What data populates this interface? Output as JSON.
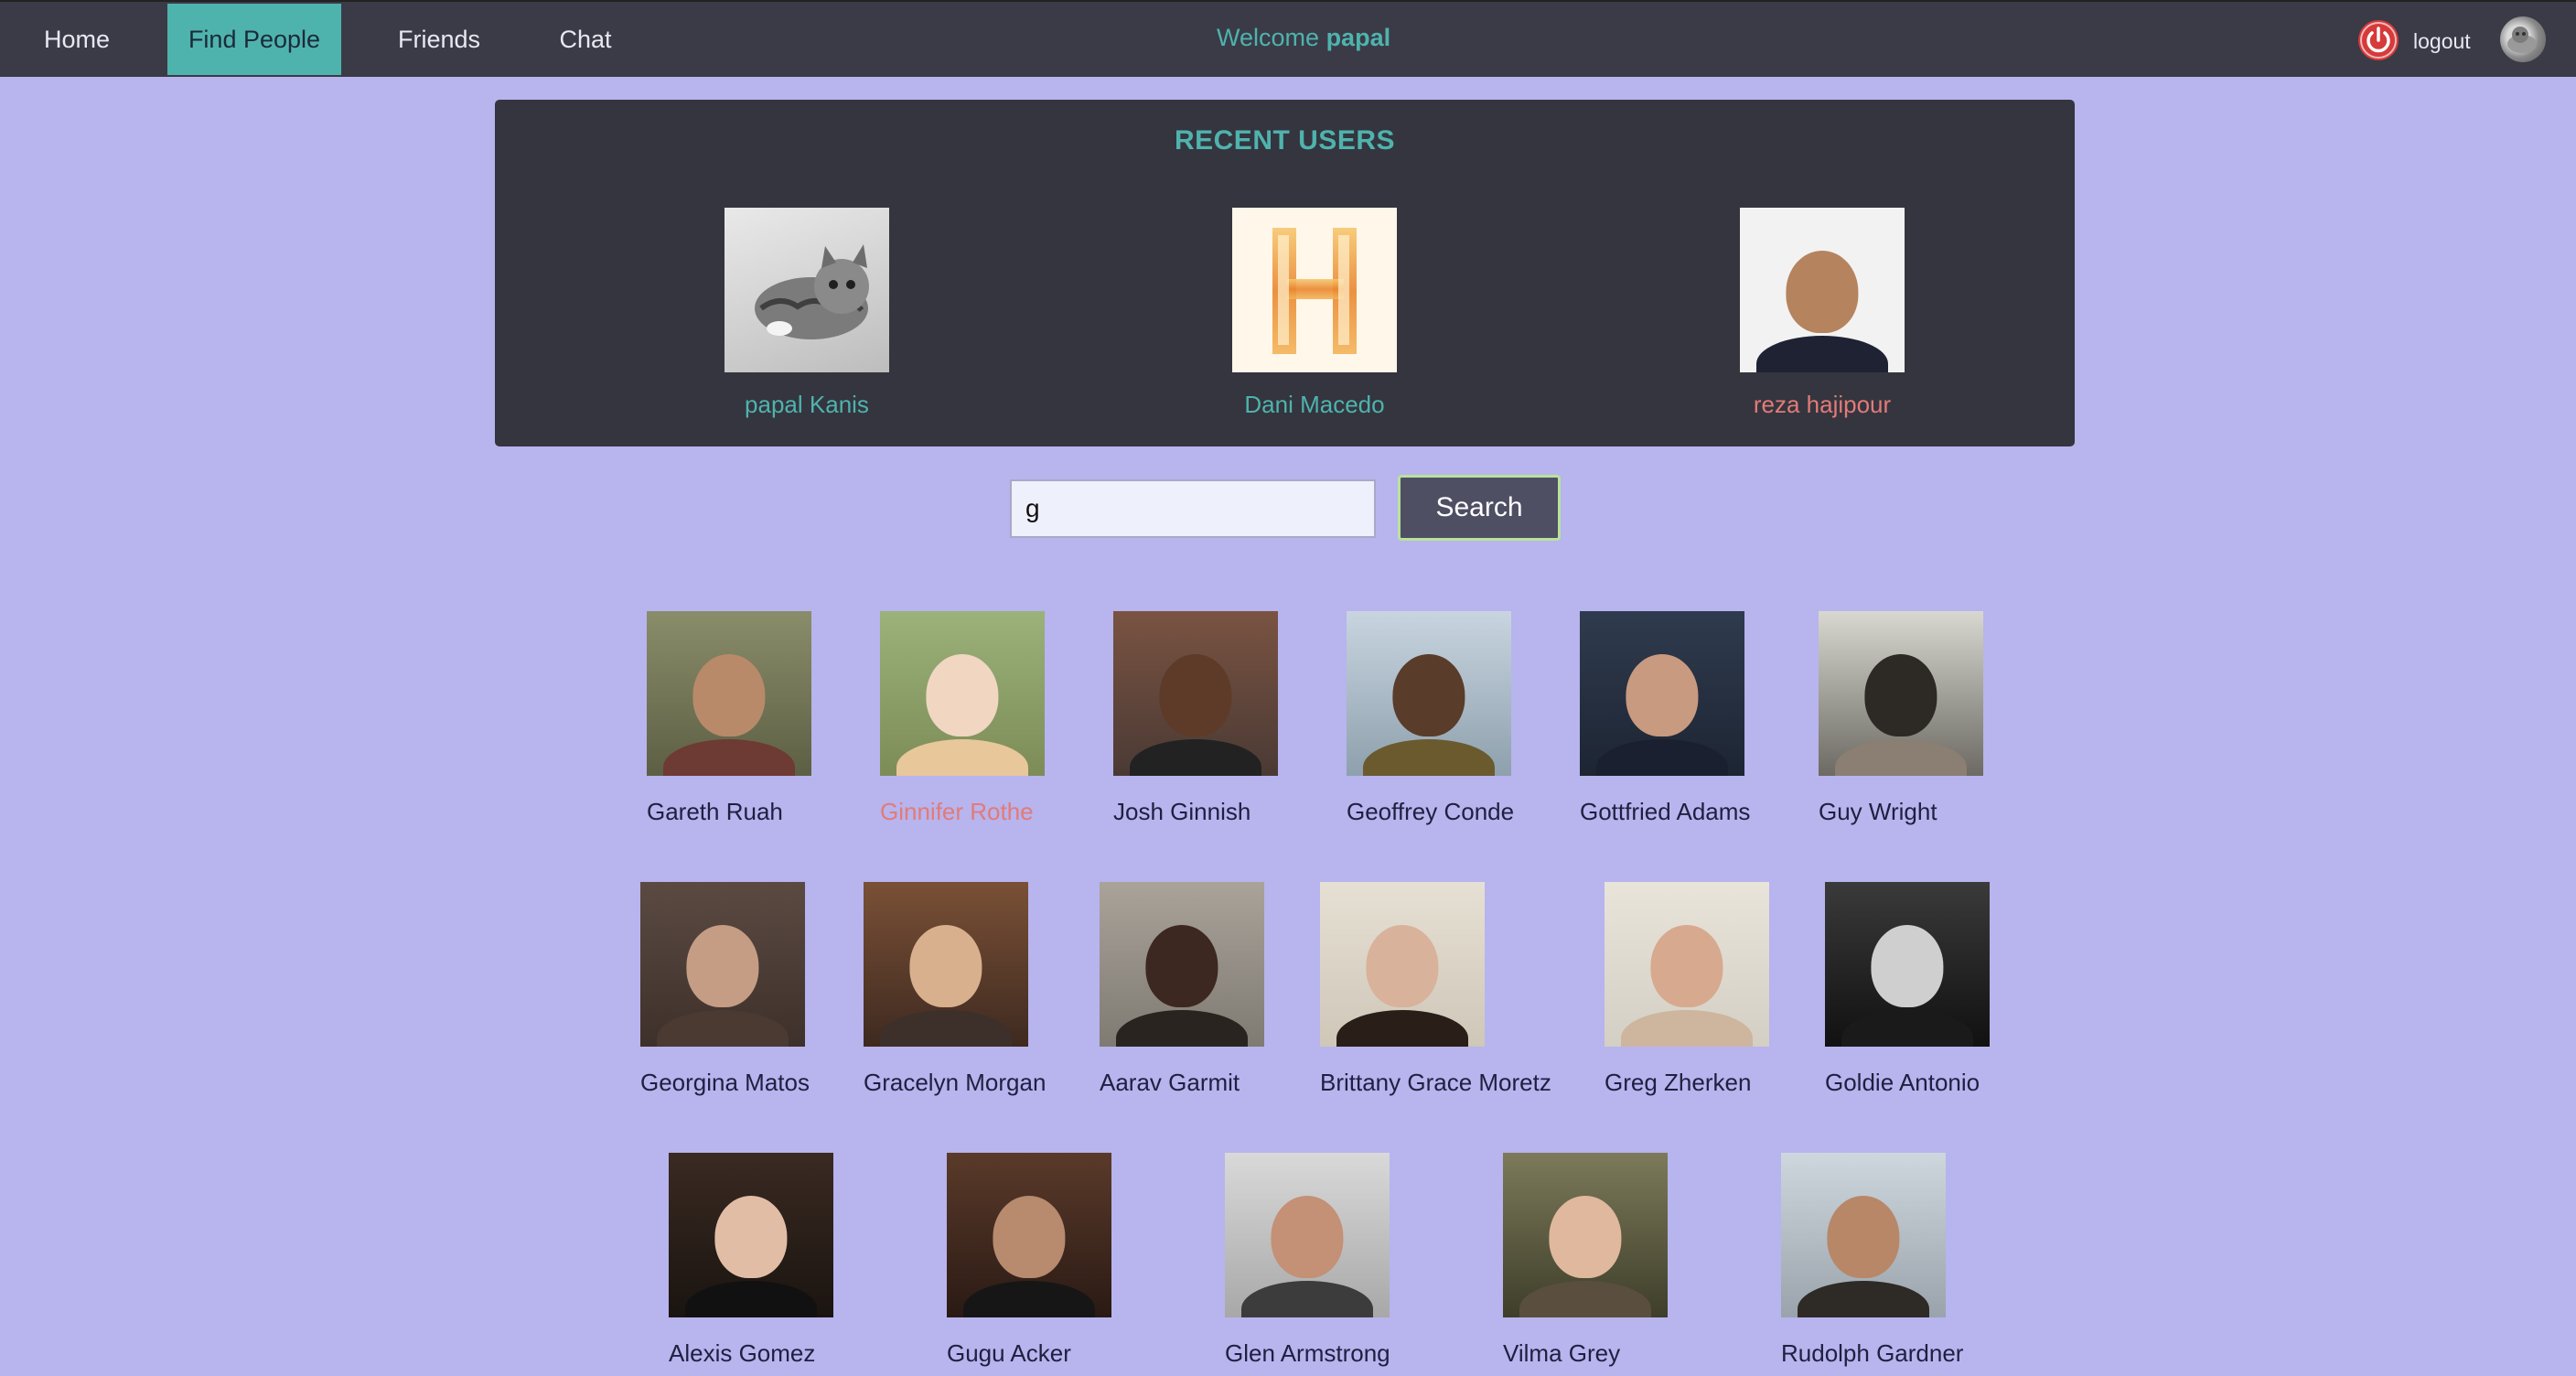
{
  "nav": {
    "items": [
      {
        "label": "Home",
        "active": false
      },
      {
        "label": "Find People",
        "active": true
      },
      {
        "label": "Friends",
        "active": false
      },
      {
        "label": "Chat",
        "active": false
      }
    ],
    "welcome_prefix": "Welcome",
    "username": "papal",
    "logout_label": "logout",
    "logout_icon": "power-icon",
    "accent_color": "#4fb3ad"
  },
  "recent": {
    "title": "RECENT USERS",
    "users": [
      {
        "name": "papal Kanis",
        "color": "#4fb3ad"
      },
      {
        "name": "Dani Macedo",
        "color": "#4fb3ad"
      },
      {
        "name": "reza hajipour",
        "color": "#e27b78"
      }
    ]
  },
  "search": {
    "value": "g",
    "button_label": "Search"
  },
  "results": {
    "rows": [
      [
        {
          "name": "Gareth Ruah"
        },
        {
          "name": "Ginnifer Rothe",
          "highlight": true
        },
        {
          "name": "Josh Ginnish"
        },
        {
          "name": "Geoffrey Conde"
        },
        {
          "name": "Gottfried Adams"
        },
        {
          "name": "Guy Wright"
        }
      ],
      [
        {
          "name": "Georgina Matos"
        },
        {
          "name": "Gracelyn Morgan"
        },
        {
          "name": "Aarav Garmit"
        },
        {
          "name": "Brittany Grace Moretz"
        },
        {
          "name": "Greg Zherken"
        },
        {
          "name": "Goldie Antonio"
        }
      ],
      [
        {
          "name": "Alexis Gomez"
        },
        {
          "name": "Gugu Acker"
        },
        {
          "name": "Glen Armstrong"
        },
        {
          "name": "Vilma Grey"
        },
        {
          "name": "Rudolph Gardner"
        }
      ]
    ]
  }
}
